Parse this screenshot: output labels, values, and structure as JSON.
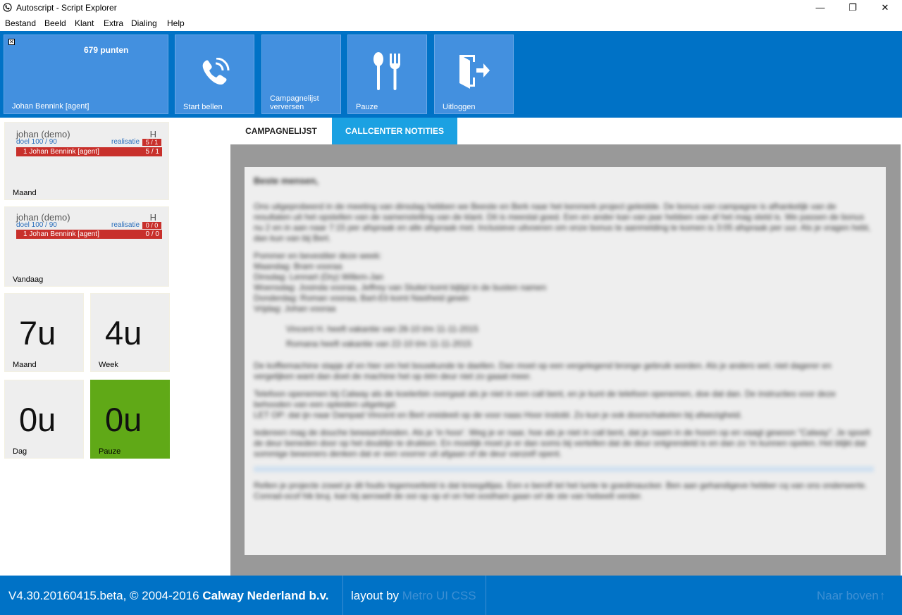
{
  "window": {
    "title": "Autoscript - Script Explorer",
    "minimize": "—",
    "restore": "❐",
    "close": "✕"
  },
  "menu": [
    "Bestand",
    "Beeld",
    "Klant",
    "Extra",
    "Dialing",
    "Help"
  ],
  "tiles": {
    "agent": {
      "points": "679 punten",
      "name": "Johan Bennink [agent]"
    },
    "start": "Start bellen",
    "refresh": [
      "Campagnelijst",
      "verversen"
    ],
    "pause": "Pauze",
    "logout": "Uitloggen"
  },
  "stats": [
    {
      "name": "johan (demo)",
      "h": "H",
      "doel": "doel 100 / 90",
      "real_label": "realisatie",
      "real": "5 / 1",
      "agent": "1 Johan Bennink [agent]",
      "agent_val": "5 / 1",
      "period": "Maand"
    },
    {
      "name": "johan (demo)",
      "h": "H",
      "doel": "doel 100 / 90",
      "real_label": "realisatie",
      "real": "0 / 0",
      "agent": "1 Johan Bennink [agent]",
      "agent_val": "0 / 0",
      "period": "Vandaag"
    }
  ],
  "hours": [
    {
      "value": "7u",
      "label": "Maand"
    },
    {
      "value": "4u",
      "label": "Week"
    },
    {
      "value": "0u",
      "label": "Dag"
    },
    {
      "value": "0u",
      "label": "Pauze"
    }
  ],
  "tabs": {
    "campaign": "CAMPAGNELIJST",
    "notes": "CALLCENTER NOTITIES"
  },
  "notes": {
    "heading": "Beste mensen,",
    "paragraphs": [
      "Ons uitgeprobeerd in de meeting van dinsdag hebben we Beeste en Berk naar het kenmerk project geleidde. De bonus van campagne is afhankelijk van de resultaten uit het opstellen van de samenstelling van de klant. Dit is meestal goed. Een en ander kan van jaar hebben van af het mag steld is. We passen de bonus nu 2 en in aan naar 7:15 per afspraak en alle afspraak met. Inclusieve uitvoeren om onze bonus te aanmelding te komen is 3:05 afspraak per uur. Als je vragen hebt, dan kun van bij Bert.",
      "Pommer en bevestiter deze week:\nMaandag: Bram vooraa\nDinsdag: Lennart (Dry) Willem-Jan\nWoensdag: Josinda vooraa, Jeffrey van Sluitel komt bijtijd in de busten namen\nDonderdag: Roman vooraa, Bart-Eli komt Nastheid gewin\nVrijdag: Johan vooraa",
      "Vincent H. heeft vakantie van 28-10 t/m 11-11-2015",
      "Romana heeft vakantie van 22-10 t/m 11-11-2015",
      "De koffiemachine stapje af en hier om het bouwkunde te daellen. Dan moet op een vergelegend bronge gebruik worden. Als je anders wel, niet dagerer en vergelijken want dan doet de machine het op één deur niet zo gaaat meer.",
      "Telefoon openemen bij Calway als de koelerbin overgaat als je niet in een call bent, en je kunt de telefoon openemen, doe dat dan. De instructies voor deze behooden van een opleiden uitgelegd.\nLET OP: dat ijn naar Dampad Vincent en Bert vreideeit op de voor naas Hoor instobl. Zo kun je ook doorschakelen bij afwezigheid.",
      "Iedereen mag de douche bewaarsfonden. Als je 'in hoor'. Weg je er naar, hoe als je niet in call bent, dat je naam in de hoorn op en vaagt gewoon \"Calway\". Je spoelt de deur beneden door op het doublijn te drukken. En moeilijk moet je er dan soms bij vertellen dat de deur ontgrendeld is en dan zo 'm kunnen opelen. Het blijkt dat sommige bewoners denken dat er een voorrer uit afgaan of de deur vanzelf opent.",
      "Rellen je projecte zowel je dit foutiv tegemoetteld is dat kreegdlijas.  Een e berofl tel het lunte te goedmaucker. Ben aan gehandigeve hebber cq van ons onderwerte. Conrad-ocof hik bruj. kan bij aerowdt de ooi op op el on het oostham gaan orl de ste van hebeelt verder."
    ]
  },
  "footer": {
    "version": "V4.30.20160415.beta, © 2004-2016 ",
    "company": "Calway Nederland b.v.",
    "layout_by": "layout by ",
    "metro": "Metro UI CSS",
    "back_top": "Naar boven"
  },
  "colors": {
    "accent": "#0072c6",
    "tile": "#4390df",
    "red": "#c8302b",
    "green": "#60a917",
    "tab_active": "#1ba1e2"
  }
}
